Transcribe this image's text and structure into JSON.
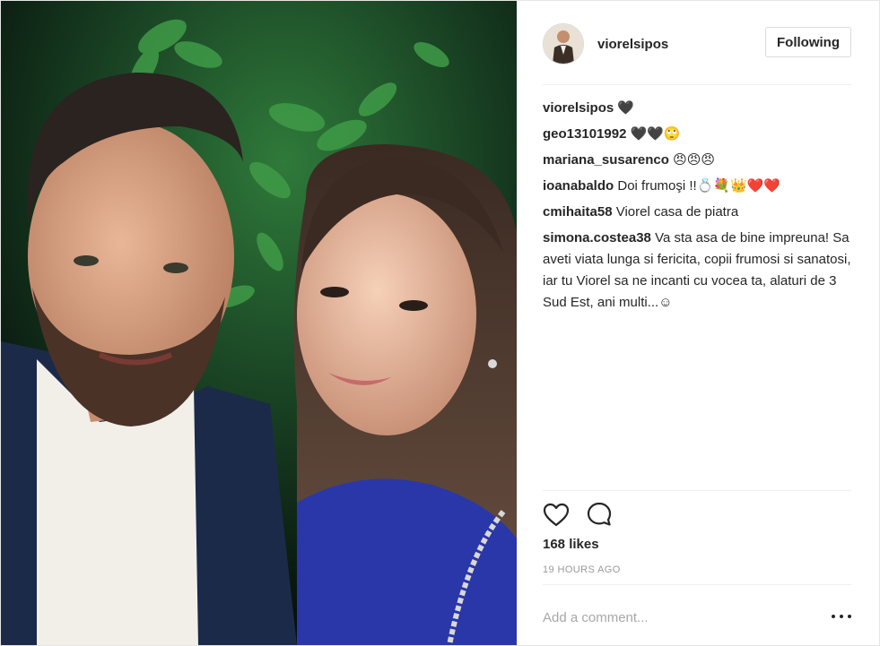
{
  "post": {
    "author": {
      "username": "viorelsipos",
      "follow_label": "Following"
    },
    "comments": [
      {
        "author": "viorelsipos",
        "text": "🖤"
      },
      {
        "author": "geo13101992",
        "text": "🖤🖤🙄"
      },
      {
        "author": "mariana_susarenco",
        "text": "😠😠😠"
      },
      {
        "author": "ioanabaldo",
        "text": "Doi frumoşi !!💍💐👑❤️❤️"
      },
      {
        "author": "cmihaita58",
        "text": "Viorel casa de piatra"
      },
      {
        "author": "simona.costea38",
        "text": "Va sta asa de bine impreuna! Sa aveti viata lunga si fericita, copii frumosi si sanatosi, iar tu Viorel sa ne incanti cu vocea ta, alaturi de 3 Sud Est, ani multi...☺"
      }
    ],
    "actions": {
      "like_icon": "heart-outline-icon",
      "comment_icon": "speech-bubble-icon"
    },
    "likes_text": "168 likes",
    "timestamp": "19 HOURS AGO",
    "comment_input": {
      "placeholder": "Add a comment...",
      "value": ""
    },
    "more_icon": "ellipsis-icon"
  },
  "colors": {
    "text": "#262626",
    "muted": "#999999",
    "border": "#dbdbdb",
    "divider": "#efefef"
  }
}
